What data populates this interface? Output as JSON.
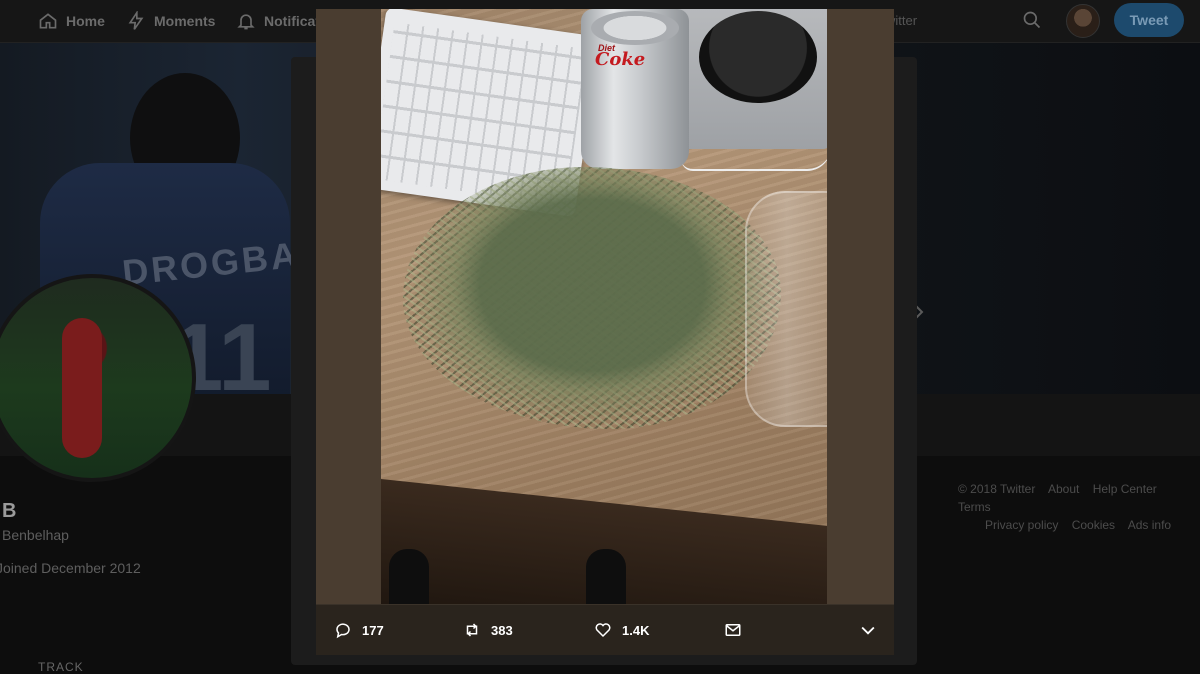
{
  "nav": {
    "items": [
      {
        "label": "Home",
        "icon": "home-icon"
      },
      {
        "label": "Moments",
        "icon": "lightning-icon"
      },
      {
        "label": "Notificati",
        "icon": "bell-icon"
      }
    ],
    "right_text": "witter",
    "tweet_button": "Tweet"
  },
  "banner": {
    "jersey_name": "DROGBA",
    "jersey_number": "11"
  },
  "profile": {
    "name": "B",
    "handle": "Benbelhap",
    "joined": "Joined December 2012"
  },
  "footer": {
    "row1": [
      "© 2018 Twitter",
      "About",
      "Help Center",
      "Terms"
    ],
    "row2": [
      "Privacy policy",
      "Cookies",
      "Ads info"
    ]
  },
  "bottom_label": "TRACK",
  "media": {
    "can_brand": "Coke",
    "can_sub": "Diet"
  },
  "actions": {
    "replies": "177",
    "retweets": "383",
    "likes": "1.4K"
  },
  "colors": {
    "action_bar": "#2a241d",
    "tweet_button": "#1d4a6d",
    "coke_red": "#c41a1f"
  }
}
